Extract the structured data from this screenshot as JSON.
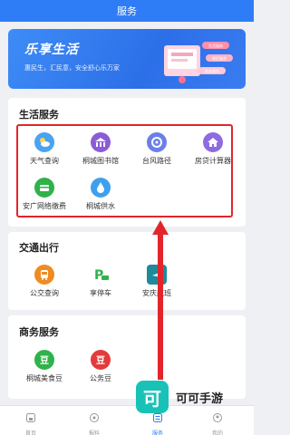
{
  "header": {
    "title": "服务"
  },
  "banner": {
    "title": "乐享生活",
    "subtitle": "惠民生，汇民意，安全舒心乐万家",
    "art_tags": [
      "生活服务",
      "便民服务",
      "政务服务"
    ]
  },
  "life_services": {
    "title": "生活服务",
    "items": [
      {
        "label": "天气查询",
        "icon": "weather-icon",
        "color": "#4aa3f0"
      },
      {
        "label": "桐城图书馆",
        "icon": "library-icon",
        "color": "#8b5cd6"
      },
      {
        "label": "台风路径",
        "icon": "typhoon-icon",
        "color": "#6b7fe8"
      },
      {
        "label": "房贷计算器",
        "icon": "house-loan-icon",
        "color": "#8e6be0"
      },
      {
        "label": "安广网络缴费",
        "icon": "network-payment-icon",
        "color": "#2fb24a"
      },
      {
        "label": "桐城供水",
        "icon": "water-drop-icon",
        "color": "#3fa0ee"
      }
    ]
  },
  "transport": {
    "title": "交通出行",
    "items": [
      {
        "label": "公交查询",
        "icon": "bus-icon",
        "color": "#f08a24"
      },
      {
        "label": "享停车",
        "icon": "parking-icon",
        "color": "#2fb24a"
      },
      {
        "label": "安庆航班",
        "icon": "flight-icon",
        "color": "#1f8a99"
      }
    ]
  },
  "business": {
    "title": "商务服务",
    "items": [
      {
        "label": "桐城美食豆",
        "icon": "food-bean-icon",
        "color": "#2fb24a"
      },
      {
        "label": "公务豆",
        "icon": "official-bean-icon",
        "color": "#e23b3b"
      }
    ]
  },
  "tabbar": {
    "items": [
      {
        "label": "首页",
        "icon": "home-icon"
      },
      {
        "label": "报料",
        "icon": "report-icon"
      },
      {
        "label": "服务",
        "icon": "service-icon",
        "active": true
      },
      {
        "label": "我的",
        "icon": "profile-icon"
      }
    ]
  },
  "watermark": {
    "logo": "可",
    "text": "可可手游"
  }
}
